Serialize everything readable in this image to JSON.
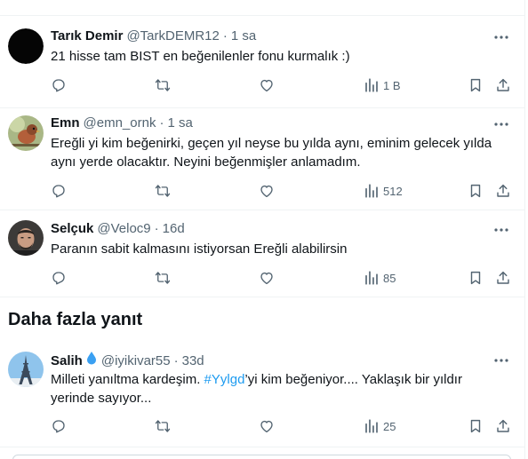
{
  "replies": [
    {
      "name": "Tarık Demir",
      "handle": "@TarkDEMR12",
      "time": "1 sa",
      "text": "21 hisse tam BIST en beğenilenler fonu kurmalık :)",
      "views": "1 B",
      "avatar": "black-avatar"
    },
    {
      "name": "Emn",
      "handle": "@emn_ornk",
      "time": "1 sa",
      "text_line1": "Ereğli yi kim beğenirki, geçen yıl neyse bu yılda aynı, eminim gelecek yılda",
      "text_line2": "aynı yerde olacaktır. Neyini beğenmişler anlamadım.",
      "views": "512",
      "avatar": "bird-avatar"
    },
    {
      "name": "Selçuk",
      "handle": "@Veloc9",
      "time": "16d",
      "text": "Paranın sabit kalmasını istiyorsan Ereğli alabilirsin",
      "views": "85",
      "avatar": "man-avatar"
    }
  ],
  "section_title": "Daha fazla yanıt",
  "more_reply": {
    "name": "Salih",
    "handle": "@iyikivar55",
    "time": "33d",
    "text_before": "Milleti yanıltma kardeşim. ",
    "hashtag": "#Yylgd",
    "text_after": "’yi kim beğeniyor.... Yaklaşık bir yıldır",
    "text_line2": "yerinde sayıyor...",
    "views": "25",
    "avatar": "eiffel-avatar",
    "badge": "water-drop-icon"
  },
  "colors": {
    "text": "#0f1419",
    "muted": "#536471",
    "accent": "#1d9bf0",
    "border": "#eff3f4"
  }
}
